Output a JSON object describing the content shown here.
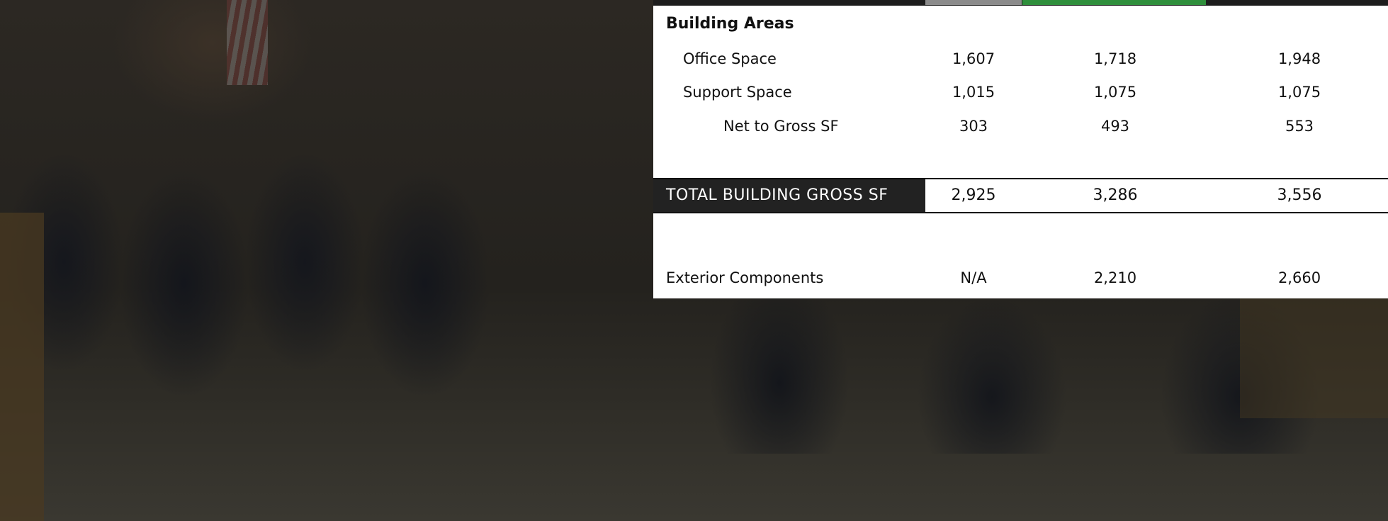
{
  "table": {
    "heading": "Building Areas",
    "rows": [
      {
        "label": "Office Space",
        "values": [
          "1,607",
          "1,718",
          "1,948"
        ]
      },
      {
        "label": "Support Space",
        "values": [
          "1,015",
          "1,075",
          "1,075"
        ]
      },
      {
        "label": "Net to Gross SF",
        "values": [
          "303",
          "493",
          "553"
        ]
      }
    ],
    "total": {
      "label": "TOTAL BUILDING GROSS SF",
      "values": [
        "2,925",
        "3,286",
        "3,556"
      ]
    },
    "exterior": {
      "label": "Exterior Components",
      "values": [
        "N/A",
        "2,210",
        "2,660"
      ]
    }
  },
  "colors": {
    "tab_gray": "#8b8b8b",
    "tab_green": "#2f8f3c",
    "total_label_bg": "#222222"
  }
}
